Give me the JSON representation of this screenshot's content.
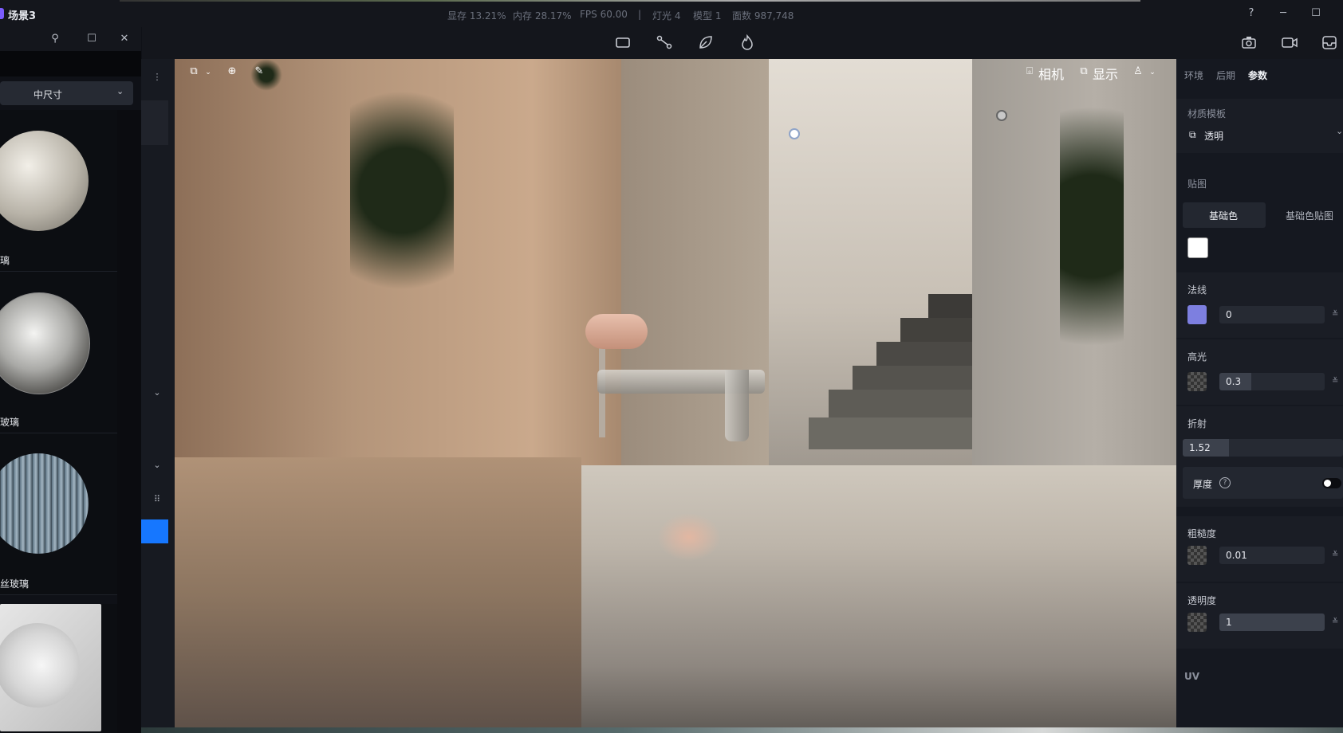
{
  "window": {
    "title": "场景3",
    "stats": {
      "vram": "显存 13.21%",
      "memory": "内存 28.17%",
      "fps": "FPS 60.00",
      "separator": "|",
      "lights": "灯光 4",
      "models": "模型 1",
      "faces": "面数 987,748"
    }
  },
  "toolbar": {
    "tools": [
      "rectangle-icon",
      "bone-icon",
      "leaf-icon",
      "fire-icon"
    ],
    "right_icons": [
      "camera-icon",
      "video-icon",
      "inbox-icon"
    ]
  },
  "library": {
    "size_select": "中尺寸",
    "items": [
      {
        "label": "璃"
      },
      {
        "label": "玻璃"
      },
      {
        "label": "丝玻璃"
      },
      {
        "label": ""
      }
    ]
  },
  "viewport": {
    "camera_label": "相机",
    "display_label": "显示"
  },
  "properties": {
    "tabs": [
      {
        "label": "环境",
        "active": false
      },
      {
        "label": "后期",
        "active": false
      },
      {
        "label": "参数",
        "active": true
      }
    ],
    "material_template": {
      "label": "材质模板",
      "value": "透明"
    },
    "maps": {
      "label": "贴图",
      "tabs": [
        "基础色",
        "基础色贴图"
      ],
      "base_color": "#ffffff"
    },
    "normal": {
      "label": "法线",
      "value": "0",
      "color": "#7d7fe0"
    },
    "specular": {
      "label": "高光",
      "value": "0.3"
    },
    "refraction": {
      "label": "折射",
      "value": "1.52",
      "thickness_label": "厚度",
      "thickness_on": false
    },
    "roughness": {
      "label": "粗糙度",
      "value": "0.01"
    },
    "opacity": {
      "label": "透明度",
      "value": "1"
    },
    "uv": {
      "label": "UV"
    }
  }
}
